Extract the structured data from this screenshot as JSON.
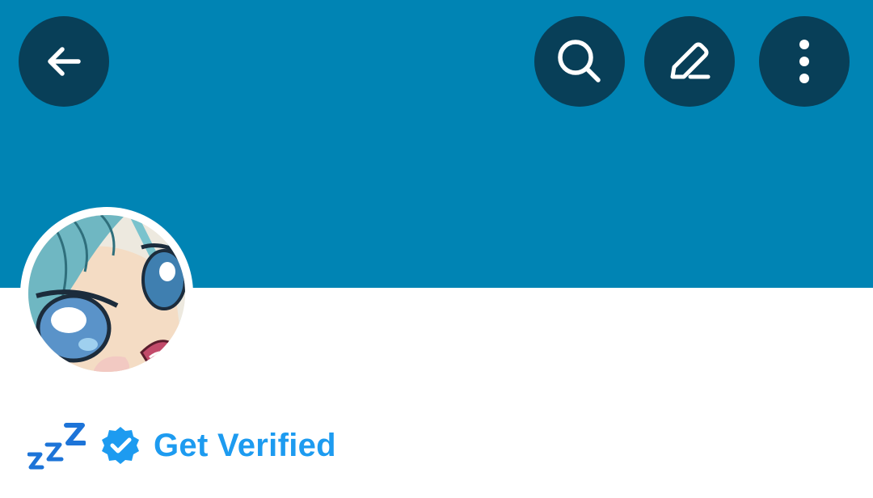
{
  "header": {
    "back_icon": "arrow-left-icon",
    "search_icon": "search-icon",
    "edit_icon": "compose-icon",
    "more_icon": "more-vertical-icon"
  },
  "colors": {
    "banner": "#0084b4",
    "nav_button": "#083f58",
    "accent": "#1d9bf0"
  },
  "profile": {
    "avatar_icon": "anime-avatar-image",
    "sleep_emoji": "zzz-icon",
    "verified_badge_icon": "verified-badge-icon",
    "get_verified_label": "Get Verified"
  }
}
